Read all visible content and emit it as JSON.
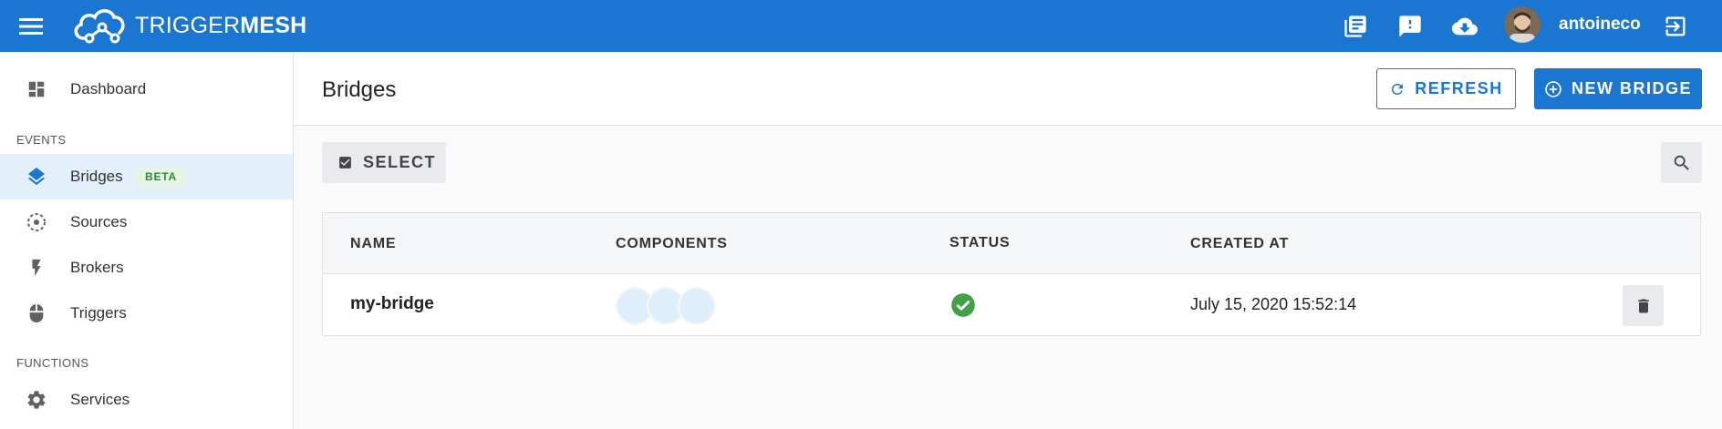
{
  "brand": {
    "name_light": "TRIGGER",
    "name_bold": "MESH"
  },
  "header": {
    "username": "antoineco",
    "icons": [
      "menu-icon",
      "docs-icon",
      "feedback-icon",
      "download-icon",
      "logout-icon"
    ]
  },
  "sidebar": {
    "items": [
      {
        "label": "Dashboard",
        "icon": "dashboard-icon"
      },
      {
        "label": "Bridges",
        "icon": "layers-icon",
        "badge": "BETA",
        "active": true
      },
      {
        "label": "Sources",
        "icon": "sources-icon"
      },
      {
        "label": "Brokers",
        "icon": "bolt-icon"
      },
      {
        "label": "Triggers",
        "icon": "mouse-icon"
      },
      {
        "label": "Services",
        "icon": "gear-icon"
      }
    ],
    "sections": {
      "events": "EVENTS",
      "functions": "FUNCTIONS"
    }
  },
  "page": {
    "title": "Bridges",
    "refresh_label": "REFRESH",
    "new_label": "NEW BRIDGE",
    "select_label": "SELECT"
  },
  "table": {
    "columns": [
      "NAME",
      "COMPONENTS",
      "STATUS",
      "CREATED AT"
    ],
    "rows": [
      {
        "name": "my-bridge",
        "components": 3,
        "status": "ready",
        "created_at": "July 15, 2020 15:52:14"
      }
    ]
  },
  "colors": {
    "primary": "#1b76d2",
    "success": "#43a047",
    "active_bg": "#e3f0fb"
  }
}
